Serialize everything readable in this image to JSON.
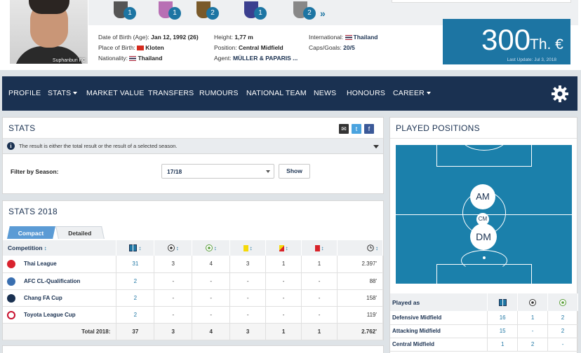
{
  "player": {
    "photo_caption": "Suphanburi FC",
    "dob_label": "Date of Birth (Age):",
    "dob_value": "Jan 12, 1992 (26)",
    "pob_label": "Place of Birth:",
    "pob_value": "Kloten",
    "nationality_label": "Nationality:",
    "nationality_value": "Thailand",
    "height_label": "Height:",
    "height_value": "1,77 m",
    "position_label": "Position:",
    "position_value": "Central Midfield",
    "agent_label": "Agent:",
    "agent_value": "MÜLLER & PAPARIS ...",
    "international_label": "International:",
    "international_value": "Thailand",
    "caps_label": "Caps/Goals:",
    "caps_value": "20/5"
  },
  "trophies": [
    {
      "count": "1",
      "icon": "trophy-icon",
      "color": "#555"
    },
    {
      "count": "1",
      "icon": "trophy-icon",
      "color": "#b86fb4"
    },
    {
      "count": "2",
      "icon": "trophy-icon",
      "color": "#7a5a2a"
    },
    {
      "count": "1",
      "icon": "trophy-icon",
      "color": "#3b3f8f"
    },
    {
      "count": "2",
      "icon": "trophy-icon",
      "color": "#888"
    }
  ],
  "market_value": {
    "value": "300",
    "unit": "Th. €",
    "last_update": "Last Update: Jul 3, 2018"
  },
  "nav": {
    "items": [
      "PROFILE",
      "STATS",
      "MARKET VALUE",
      "TRANSFERS",
      "RUMOURS",
      "NATIONAL TEAM",
      "NEWS",
      "HONOURS",
      "CAREER"
    ]
  },
  "stats_box": {
    "title": "STATS",
    "notice": "The result is either the total result or the result of a selected season.",
    "filter_label": "Filter by Season:",
    "season_value": "17/18",
    "show_button": "Show"
  },
  "stats_year": {
    "title": "STATS 2018",
    "tab_compact": "Compact",
    "tab_detailed": "Detailed",
    "col_competition": "Competition",
    "rows": [
      {
        "competition": "Thai League",
        "apps": "31",
        "goals": "3",
        "assists": "4",
        "yellow": "3",
        "second_yellow": "1",
        "red": "1",
        "minutes": "2.397'",
        "logo_color": "#d9232e"
      },
      {
        "competition": "AFC CL-Qualification",
        "apps": "2",
        "goals": "-",
        "assists": "-",
        "yellow": "-",
        "second_yellow": "-",
        "red": "-",
        "minutes": "88'",
        "logo_color": "#3a6fb0"
      },
      {
        "competition": "Chang FA Cup",
        "apps": "2",
        "goals": "-",
        "assists": "-",
        "yellow": "-",
        "second_yellow": "-",
        "red": "-",
        "minutes": "158'",
        "logo_color": "#1a3151"
      },
      {
        "competition": "Toyota League Cup",
        "apps": "2",
        "goals": "-",
        "assists": "-",
        "yellow": "-",
        "second_yellow": "-",
        "red": "-",
        "minutes": "119'",
        "logo_color": "#c8102e"
      }
    ],
    "total": {
      "label": "Total 2018:",
      "apps": "37",
      "goals": "3",
      "assists": "4",
      "yellow": "3",
      "second_yellow": "1",
      "red": "1",
      "minutes": "2.762'"
    }
  },
  "positions": {
    "title": "PLAYED POSITIONS",
    "badges": [
      "AM",
      "CM",
      "DM"
    ],
    "played_as_label": "Played as",
    "rows": [
      {
        "position": "Defensive Midfield",
        "apps": "16",
        "goals": "1",
        "assists": "2"
      },
      {
        "position": "Attacking Midfield",
        "apps": "15",
        "goals": "-",
        "assists": "2"
      },
      {
        "position": "Central Midfield",
        "apps": "1",
        "goals": "2",
        "assists": "-"
      }
    ]
  },
  "colors": {
    "navy": "#1a3151",
    "accent": "#1d75a3",
    "pitch": "#1b80ab"
  }
}
